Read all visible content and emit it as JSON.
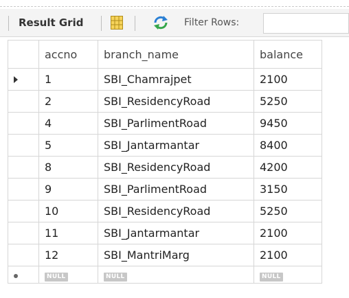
{
  "toolbar": {
    "result_grid_label": "Result Grid",
    "filter_label": "Filter Rows:",
    "filter_value": ""
  },
  "columns": [
    "accno",
    "branch_name",
    "balance"
  ],
  "rows": [
    {
      "accno": "1",
      "branch_name": "SBI_Chamrajpet",
      "balance": "2100"
    },
    {
      "accno": "2",
      "branch_name": "SBI_ResidencyRoad",
      "balance": "5250"
    },
    {
      "accno": "4",
      "branch_name": "SBI_ParlimentRoad",
      "balance": "9450"
    },
    {
      "accno": "5",
      "branch_name": "SBI_Jantarmantar",
      "balance": "8400"
    },
    {
      "accno": "8",
      "branch_name": "SBI_ResidencyRoad",
      "balance": "4200"
    },
    {
      "accno": "9",
      "branch_name": "SBI_ParlimentRoad",
      "balance": "3150"
    },
    {
      "accno": "10",
      "branch_name": "SBI_ResidencyRoad",
      "balance": "5250"
    },
    {
      "accno": "11",
      "branch_name": "SBI_Jantarmantar",
      "balance": "2100"
    },
    {
      "accno": "12",
      "branch_name": "SBI_MantriMarg",
      "balance": "2100"
    }
  ],
  "null_row": {
    "accno": "NULL",
    "branch_name": "NULL",
    "balance": "NULL"
  },
  "icons": {
    "grid": "grid-view-icon",
    "refresh": "refresh-icon",
    "current_row": "current-row-arrow-icon",
    "new_row": "new-row-icon"
  }
}
